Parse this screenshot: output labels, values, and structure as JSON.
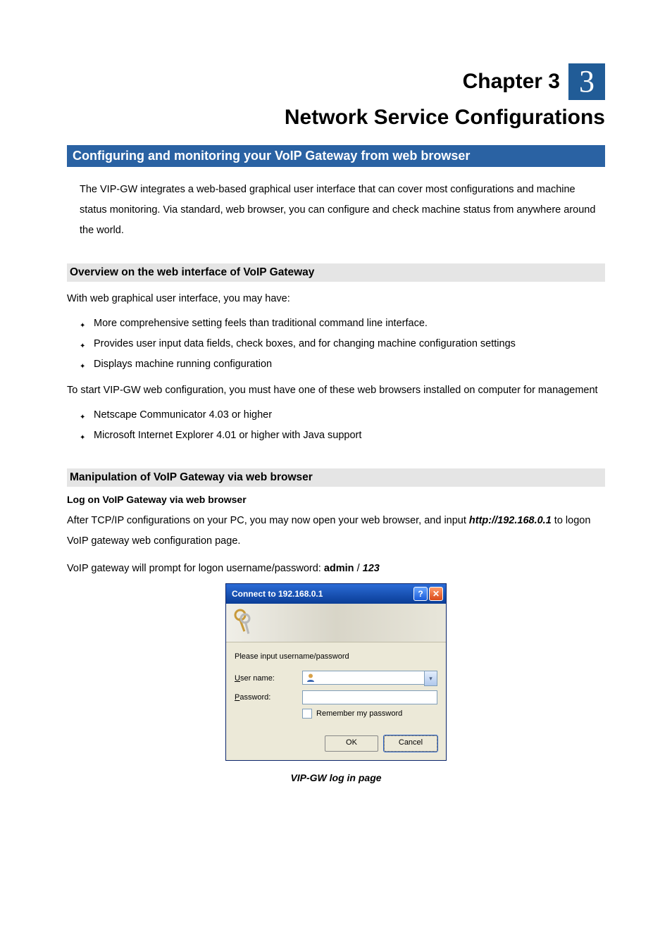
{
  "chapter": {
    "label": "Chapter 3",
    "number": "3"
  },
  "title": "Network Service Configurations",
  "banner": "Configuring and monitoring your VoIP Gateway from web browser",
  "intro": "The VIP-GW integrates a web-based graphical user interface that can cover most configurations and machine status monitoring. Via standard, web browser, you can configure and check machine status from anywhere around the world.",
  "overview": {
    "heading": "Overview on the web interface of VoIP Gateway",
    "lead": "With web graphical user interface, you may have:",
    "bullets": [
      "More comprehensive setting feels than traditional command line interface.",
      "Provides user input data fields, check boxes, and for changing machine configuration settings",
      "Displays machine running configuration"
    ],
    "para2": "To start VIP-GW web configuration, you must have one of these web browsers installed on computer for management",
    "browsers": [
      "Netscape Communicator 4.03 or higher",
      "Microsoft Internet Explorer 4.01 or higher with Java support"
    ]
  },
  "manip": {
    "heading": "Manipulation of VoIP Gateway via web browser",
    "sub": "Log on VoIP Gateway via web browser",
    "p1_a": "After TCP/IP configurations on your PC, you may now open your web browser, and input ",
    "p1_url": "http://192.168.0.1",
    "p1_b": " to logon VoIP gateway web configuration page.",
    "p2_a": "VoIP gateway will prompt for logon username/password: ",
    "p2_user": "admin",
    "p2_sep": " / ",
    "p2_pass": "123"
  },
  "dialog": {
    "title": "Connect to 192.168.0.1",
    "help": "?",
    "close": "✕",
    "prompt": "Please input username/password",
    "user_label_pre": "U",
    "user_label_post": "ser name:",
    "pass_label_pre": "P",
    "pass_label_post": "assword:",
    "remember_pre": "R",
    "remember_post": "emember my password",
    "ok": "OK",
    "cancel": "Cancel",
    "chevron": "▾"
  },
  "caption": "VIP-GW log in page"
}
